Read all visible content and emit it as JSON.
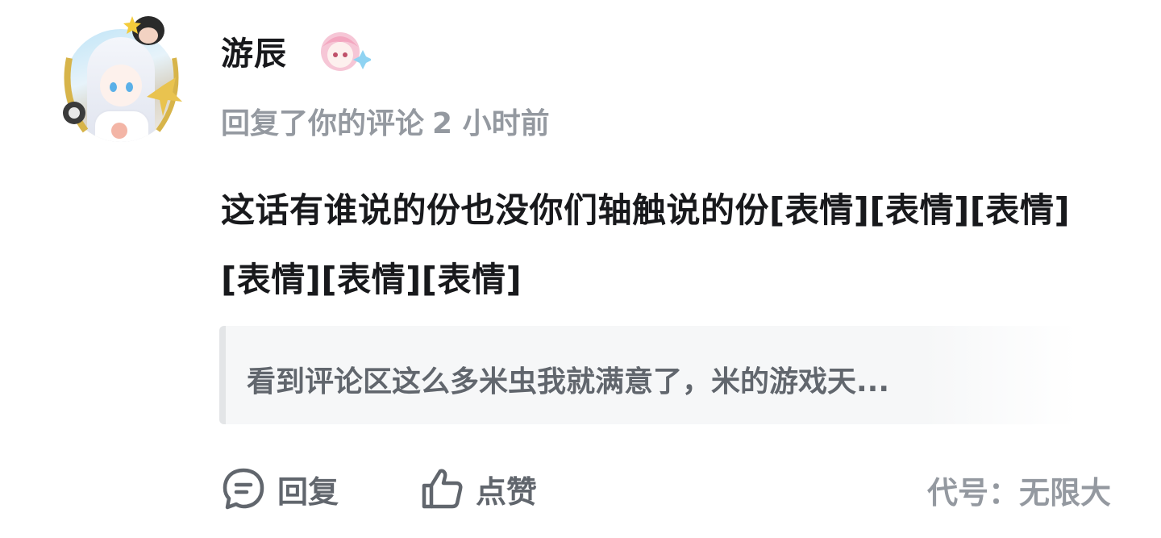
{
  "user": {
    "name": "游辰",
    "avatar_icon": "anime-girl-avatar",
    "frame_icon": "gold-avatar-frame",
    "badge_icon": "pink-hair-chibi-badge"
  },
  "notice": {
    "action_text": "回复了你的评论",
    "time": "2 小时前"
  },
  "reply": {
    "content": "这话有谁说的份也没你们轴触说的份[表情][表情][表情][表情][表情][表情]"
  },
  "quote": {
    "text": "看到评论区这么多米虫我就满意了，米的游戏天..."
  },
  "footer": {
    "reply_label": "回复",
    "like_label": "点赞",
    "nickname": "代号：无限大"
  },
  "colors": {
    "text_primary": "#18191c",
    "text_secondary": "#9499a0",
    "text_action": "#61666d",
    "quote_bg": "#f6f7f8",
    "quote_bar": "#e3e5e7"
  }
}
